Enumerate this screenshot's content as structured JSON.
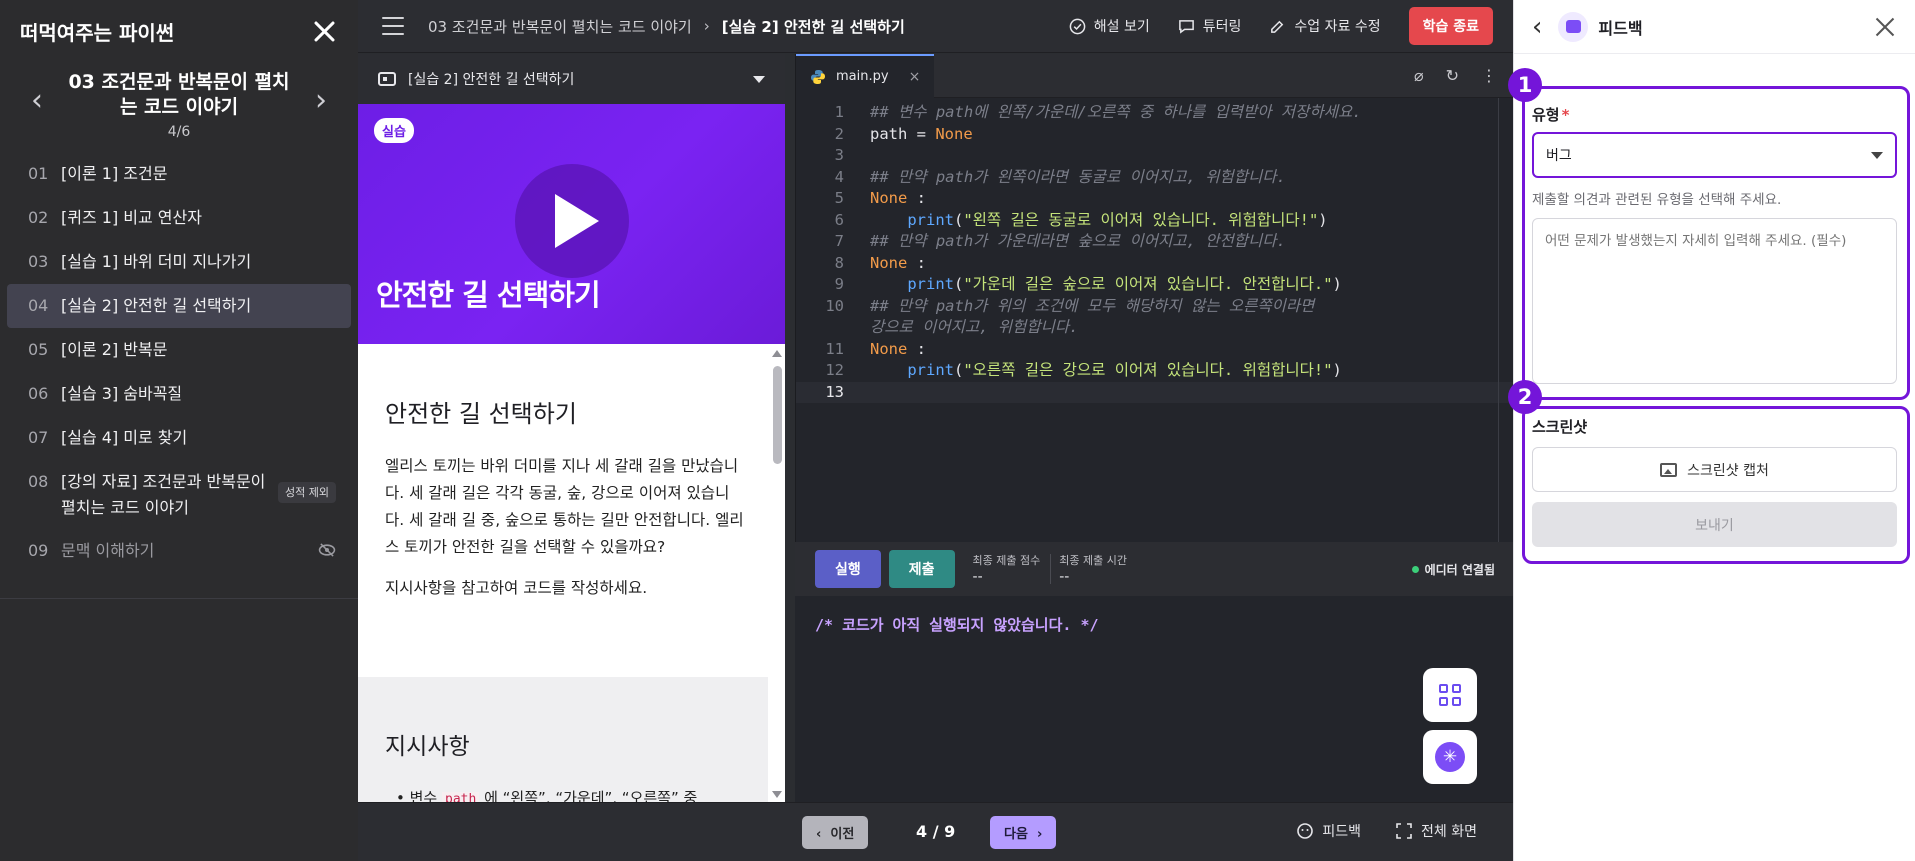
{
  "sidebar": {
    "title": "떠먹여주는 파이썬",
    "chapter_title": "03 조건문과 반복문이 펼치는 코드 이야기",
    "chapter_progress": "4/6",
    "items": [
      {
        "num": "01",
        "label": "[이론 1] 조건문"
      },
      {
        "num": "02",
        "label": "[퀴즈 1] 비교 연산자"
      },
      {
        "num": "03",
        "label": "[실습 1] 바위 더미 지나가기"
      },
      {
        "num": "04",
        "label": "[실습 2] 안전한 길 선택하기"
      },
      {
        "num": "05",
        "label": "[이론 2] 반복문"
      },
      {
        "num": "06",
        "label": "[실습 3] 숨바꼭질"
      },
      {
        "num": "07",
        "label": "[실습 4] 미로 찾기"
      },
      {
        "num": "08",
        "label": "[강의 자료] 조건문과 반복문이 펼치는 코드 이야기",
        "badge": "성적 제외"
      },
      {
        "num": "09",
        "label": "문맥 이해하기"
      }
    ]
  },
  "topbar": {
    "breadcrumb_chapter": "03 조건문과 반복문이 펼치는 코드 이야기",
    "breadcrumb_current": "[실습 2] 안전한 길 선택하기",
    "solution": "해설 보기",
    "tutoring": "튜터링",
    "edit_material": "수업 자료 수정",
    "end_study": "학습 종료"
  },
  "content": {
    "header": "[실습 2] 안전한 길 선택하기",
    "banner_tag": "실습",
    "banner_title": "안전한 길 선택하기",
    "title": "안전한 길 선택하기",
    "paragraph1": "엘리스 토끼는 바위 더미를 지나 세 갈래 길을 만났습니다. 세 갈래 길은 각각 동굴, 숲, 강으로 이어져 있습니다. 세 갈래 길 중, 숲으로 통하는 길만 안전합니다. 엘리스 토끼가 안전한 길을 선택할 수 있을까요?",
    "paragraph2": "지시사항을 참고하여 코드를 작성하세요.",
    "instructions_title": "지시사항",
    "instruction_prefix": "변수 ",
    "instruction_code": "path",
    "instruction_rest": " 에 “왼쪽”, “가운데”, “오른쪽” 중"
  },
  "editor": {
    "filename": "main.py",
    "lines": [
      {
        "n": "1",
        "parts": [
          {
            "t": "## 변수 path에 왼쪽/가운데/오른쪽 중 하나를 입력받아 저장하세요.",
            "c": "cmt"
          }
        ]
      },
      {
        "n": "2",
        "parts": [
          {
            "t": "path = ",
            "c": ""
          },
          {
            "t": "None",
            "c": "kw"
          }
        ]
      },
      {
        "n": "3",
        "parts": []
      },
      {
        "n": "4",
        "parts": [
          {
            "t": "## 만약 path가 왼쪽이라면 동굴로 이어지고, 위험합니다.",
            "c": "cmt"
          }
        ]
      },
      {
        "n": "5",
        "parts": [
          {
            "t": "None",
            "c": "kw"
          },
          {
            "t": " :",
            "c": ""
          }
        ]
      },
      {
        "n": "6",
        "parts": [
          {
            "t": "    ",
            "c": ""
          },
          {
            "t": "print",
            "c": "fn"
          },
          {
            "t": "(",
            "c": ""
          },
          {
            "t": "\"왼쪽 길은 동굴로 이어져 있습니다. 위험합니다!\"",
            "c": "str"
          },
          {
            "t": ")",
            "c": ""
          }
        ]
      },
      {
        "n": "7",
        "parts": [
          {
            "t": "## 만약 path가 가운데라면 숲으로 이어지고, 안전합니다.",
            "c": "cmt"
          }
        ]
      },
      {
        "n": "8",
        "parts": [
          {
            "t": "None",
            "c": "kw"
          },
          {
            "t": " :",
            "c": ""
          }
        ]
      },
      {
        "n": "9",
        "parts": [
          {
            "t": "    ",
            "c": ""
          },
          {
            "t": "print",
            "c": "fn"
          },
          {
            "t": "(",
            "c": ""
          },
          {
            "t": "\"가운데 길은 숲으로 이어져 있습니다. 안전합니다.\"",
            "c": "str"
          },
          {
            "t": ")",
            "c": ""
          }
        ]
      },
      {
        "n": "10",
        "parts": [
          {
            "t": "## 만약 path가 위의 조건에 모두 해당하지 않는 오른쪽이라면",
            "c": "cmt"
          }
        ]
      },
      {
        "n": "",
        "parts": [
          {
            "t": "강으로 이어지고, 위험합니다.",
            "c": "cmt"
          }
        ]
      },
      {
        "n": "11",
        "parts": [
          {
            "t": "None",
            "c": "kw"
          },
          {
            "t": " :",
            "c": ""
          }
        ]
      },
      {
        "n": "12",
        "parts": [
          {
            "t": "    ",
            "c": ""
          },
          {
            "t": "print",
            "c": "fn"
          },
          {
            "t": "(",
            "c": ""
          },
          {
            "t": "\"오른쪽 길은 강으로 이어져 있습니다. 위험합니다!\"",
            "c": "str"
          },
          {
            "t": ")",
            "c": ""
          }
        ]
      },
      {
        "n": "13",
        "parts": []
      }
    ]
  },
  "runbar": {
    "run": "실행",
    "submit": "제출",
    "last_score_label": "최종 제출 점수",
    "last_score_value": "--",
    "last_time_label": "최종 제출 시간",
    "last_time_value": "--",
    "status": "에디터 연결됨"
  },
  "console": {
    "output": "/* 코드가 아직 실행되지 않았습니다. */"
  },
  "bottombar": {
    "prev": "이전",
    "page": "4 / 9",
    "next": "다음",
    "feedback": "피드백",
    "fullscreen": "전체 화면"
  },
  "panel": {
    "title": "피드백",
    "marker1": "1",
    "marker2": "2",
    "type_label": "유형",
    "required_mark": "*",
    "type_value": "버그",
    "type_hint": "제출할 의견과 관련된 유형을 선택해 주세요.",
    "detail_placeholder": "어떤 문제가 발생했는지 자세히 입력해 주세요. (필수)",
    "screenshot_label": "스크린샷",
    "screenshot_button": "스크린샷 캡처",
    "send": "보내기"
  },
  "colors": {
    "accent_purple": "#7415d9",
    "end_button": "#e5484d",
    "run_button": "#5b5fc7",
    "submit_button": "#2f8a84",
    "banner": "#7a23f2"
  }
}
